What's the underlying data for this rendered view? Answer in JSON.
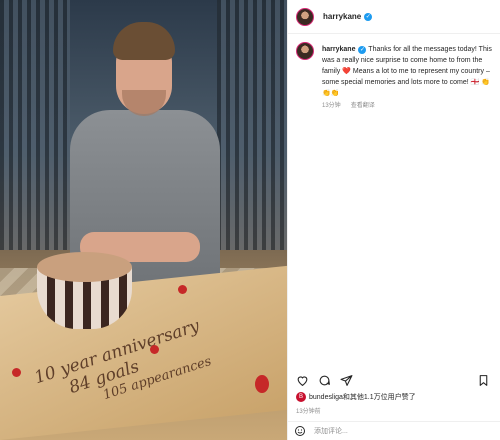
{
  "post": {
    "username": "harrykane",
    "verified_mark": "✓",
    "caption": "Thanks for all the messages today! This was a really nice surprise to come home to from the family ❤️ Means a lot to me to represent my country – some special memories and lots more to come! 🏴󠁧󠁢󠁥󠁮󠁧󠁿 👏👏👏",
    "time_ago": "13分钟",
    "see_translation": "查看翻译",
    "likes_text": "bundesliga和其他1.1万位用户赞了",
    "likes_badge": "B",
    "time_posted": "13分钟前",
    "comment_placeholder": "添加评论..."
  },
  "photo": {
    "cake_writing_line1": "10 year anniversary",
    "cake_writing_line2": "84 goals",
    "cake_writing_line3": "105 appearances"
  },
  "icons": [
    "heart-icon",
    "comment-icon",
    "share-icon",
    "bookmark-icon",
    "smiley-icon"
  ],
  "colors": {
    "verified": "#1d9bf0",
    "story_ring": "#d62976",
    "like_badge": "#c8102e"
  }
}
